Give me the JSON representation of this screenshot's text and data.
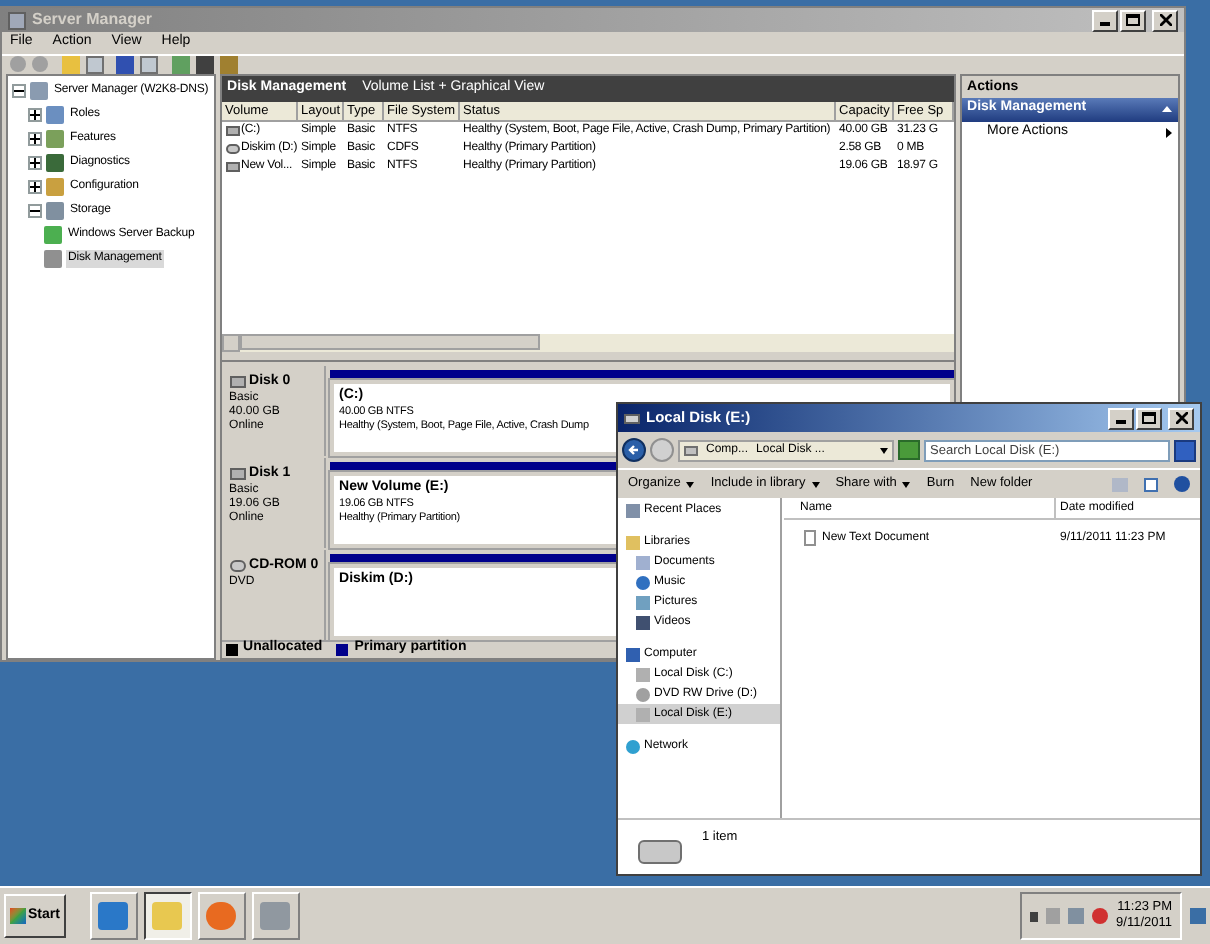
{
  "server_manager": {
    "title": "Server Manager",
    "menu": [
      "File",
      "Action",
      "View",
      "Help"
    ],
    "tree": [
      {
        "label": "Server Manager (W2K8-DNS)",
        "kind": "server",
        "expanded": true,
        "selected": false,
        "children": [
          {
            "label": "Roles",
            "kind": "roles",
            "expanded": false,
            "selected": false
          },
          {
            "label": "Features",
            "kind": "features",
            "expanded": false,
            "selected": false
          },
          {
            "label": "Diagnostics",
            "kind": "diagnostics",
            "expanded": false,
            "selected": false
          },
          {
            "label": "Configuration",
            "kind": "configuration",
            "expanded": false,
            "selected": false
          },
          {
            "label": "Storage",
            "kind": "storage",
            "expanded": true,
            "selected": false,
            "children": [
              {
                "label": "Windows Server Backup",
                "kind": "backup",
                "selected": false
              },
              {
                "label": "Disk Management",
                "kind": "disk",
                "selected": true
              }
            ]
          }
        ]
      }
    ],
    "disk_management": {
      "title": "Disk Management",
      "subtitle": "Volume List + Graphical View",
      "columns": [
        "Volume",
        "Layout",
        "Type",
        "File System",
        "Status",
        "Capacity",
        "Free Sp"
      ],
      "rows": [
        {
          "kind": "disk",
          "cells": [
            "(C:)",
            "Simple",
            "Basic",
            "NTFS",
            "Healthy (System, Boot, Page File, Active, Crash Dump, Primary Partition)",
            "40.00 GB",
            "31.23 G"
          ]
        },
        {
          "kind": "cd",
          "cells": [
            "Diskim (D:)",
            "Simple",
            "Basic",
            "CDFS",
            "Healthy (Primary Partition)",
            "2.58 GB",
            "0 MB"
          ]
        },
        {
          "kind": "disk",
          "cells": [
            "New Vol...",
            "Simple",
            "Basic",
            "NTFS",
            "Healthy (Primary Partition)",
            "19.06 GB",
            "18.97 G"
          ]
        }
      ],
      "disks": [
        {
          "kind": "disk",
          "name": "Disk 0",
          "lines": [
            "Basic",
            "40.00 GB",
            "Online"
          ],
          "partition": {
            "name": "(C:)",
            "lines": [
              "40.00 GB NTFS",
              "Healthy (System, Boot, Page File, Active, Crash Dump"
            ]
          }
        },
        {
          "kind": "disk",
          "name": "Disk 1",
          "lines": [
            "Basic",
            "19.06 GB",
            "Online"
          ],
          "partition": {
            "name": "New Volume  (E:)",
            "lines": [
              "19.06 GB NTFS",
              "Healthy (Primary Partition)"
            ]
          }
        },
        {
          "kind": "cd",
          "name": "CD-ROM 0",
          "lines": [
            "DVD"
          ],
          "partition": {
            "name": "Diskim  (D:)"
          }
        }
      ],
      "legend": [
        {
          "label": "Unallocated",
          "color": "#000000"
        },
        {
          "label": "Primary partition",
          "color": "#00008b"
        }
      ]
    },
    "actions": {
      "title": "Actions",
      "section": "Disk Management",
      "items": [
        "More Actions"
      ]
    }
  },
  "explorer": {
    "title": "Local Disk (E:)",
    "breadcrumb": [
      "Comp...",
      "Local Disk ..."
    ],
    "search": {
      "placeholder": "Search Local Disk (E:)"
    },
    "toolbar": [
      {
        "label": "Organize",
        "dropdown": true
      },
      {
        "label": "Include in library",
        "dropdown": true
      },
      {
        "label": "Share with",
        "dropdown": true
      },
      {
        "label": "Burn",
        "dropdown": false
      },
      {
        "label": "New folder",
        "dropdown": false
      }
    ],
    "nav": [
      {
        "label": "Recent Places",
        "kind": "recent",
        "selected": false
      },
      {
        "label": "Libraries",
        "kind": "library",
        "selected": false,
        "children": [
          {
            "label": "Documents",
            "kind": "documents",
            "selected": false
          },
          {
            "label": "Music",
            "kind": "music",
            "selected": false
          },
          {
            "label": "Pictures",
            "kind": "pictures",
            "selected": false
          },
          {
            "label": "Videos",
            "kind": "videos",
            "selected": false
          }
        ]
      },
      {
        "label": "Computer",
        "kind": "computer",
        "selected": false,
        "children": [
          {
            "label": "Local Disk (C:)",
            "kind": "drive",
            "selected": false
          },
          {
            "label": "DVD RW Drive (D:)",
            "kind": "dvd",
            "selected": false
          },
          {
            "label": "Local Disk (E:)",
            "kind": "drive",
            "selected": true
          }
        ]
      },
      {
        "label": "Network",
        "kind": "network",
        "selected": false
      }
    ],
    "columns": [
      "Name",
      "Date modified"
    ],
    "files": [
      {
        "name": "New Text Document",
        "date": "9/11/2011 11:23 PM"
      }
    ],
    "status": "1 item"
  },
  "taskbar": {
    "start": "Start",
    "apps": [
      {
        "kind": "powershell",
        "active": false
      },
      {
        "kind": "explorer",
        "active": true
      },
      {
        "kind": "browser",
        "active": false
      },
      {
        "kind": "server",
        "active": false
      }
    ],
    "time": "11:23 PM",
    "date": "9/11/2011"
  }
}
